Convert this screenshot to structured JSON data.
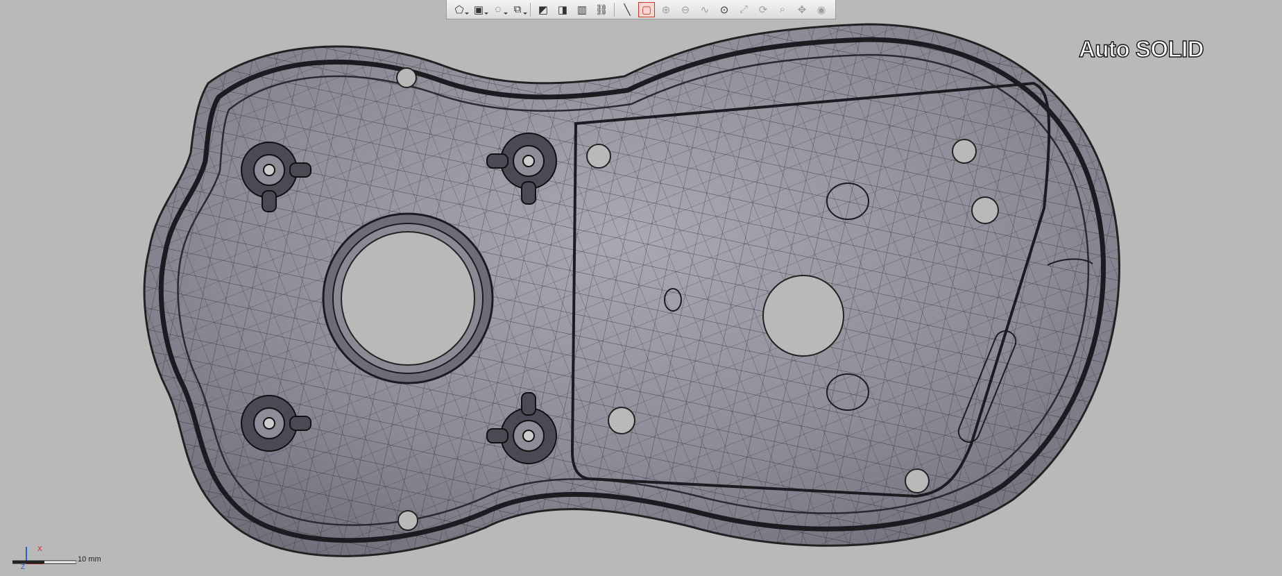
{
  "viewport": {
    "mode_label": "Auto SOLID",
    "scale_label": "10 mm",
    "axis_x_label": "X",
    "axis_z_label": "Z"
  },
  "toolbar": {
    "buttons": [
      {
        "name": "mesh-select-tool-button",
        "icon": "polygon-icon",
        "dropdown": true
      },
      {
        "name": "box-view-button",
        "icon": "cube-icon",
        "dropdown": true
      },
      {
        "name": "lasso-select-button",
        "icon": "lasso-icon",
        "dropdown": true
      },
      {
        "name": "view-orientation-button",
        "icon": "iso-view-icon",
        "dropdown": true
      },
      {
        "name": "plane-section-button",
        "icon": "plane-icon"
      },
      {
        "name": "align-button",
        "icon": "align-icon"
      },
      {
        "name": "split-view-button",
        "icon": "split-icon"
      },
      {
        "name": "measure-button",
        "icon": "measure-icon"
      },
      {
        "name": "line-tool-button",
        "icon": "line-icon"
      },
      {
        "name": "rectangle-select-button",
        "icon": "rectangle-icon",
        "active": true
      },
      {
        "name": "add-point-button",
        "icon": "add-point-icon",
        "disabled": true
      },
      {
        "name": "remove-point-button",
        "icon": "remove-point-icon",
        "disabled": true
      },
      {
        "name": "smooth-button",
        "icon": "smooth-icon",
        "disabled": true
      },
      {
        "name": "lasso-zoom-button",
        "icon": "lasso-zoom-icon"
      },
      {
        "name": "fit-button",
        "icon": "fit-icon",
        "disabled": true
      },
      {
        "name": "rotate-button",
        "icon": "rotate-icon",
        "disabled": true
      },
      {
        "name": "zoom-button",
        "icon": "zoom-icon",
        "disabled": true
      },
      {
        "name": "pan-button",
        "icon": "pan-icon",
        "disabled": true
      },
      {
        "name": "visibility-button",
        "icon": "eye-icon",
        "disabled": true
      }
    ],
    "accent_color": "#c0392b"
  },
  "model": {
    "surface_color": "#8e8e99",
    "edge_color": "#1a1a1a",
    "description_icon": "cad-mesh-plate"
  }
}
